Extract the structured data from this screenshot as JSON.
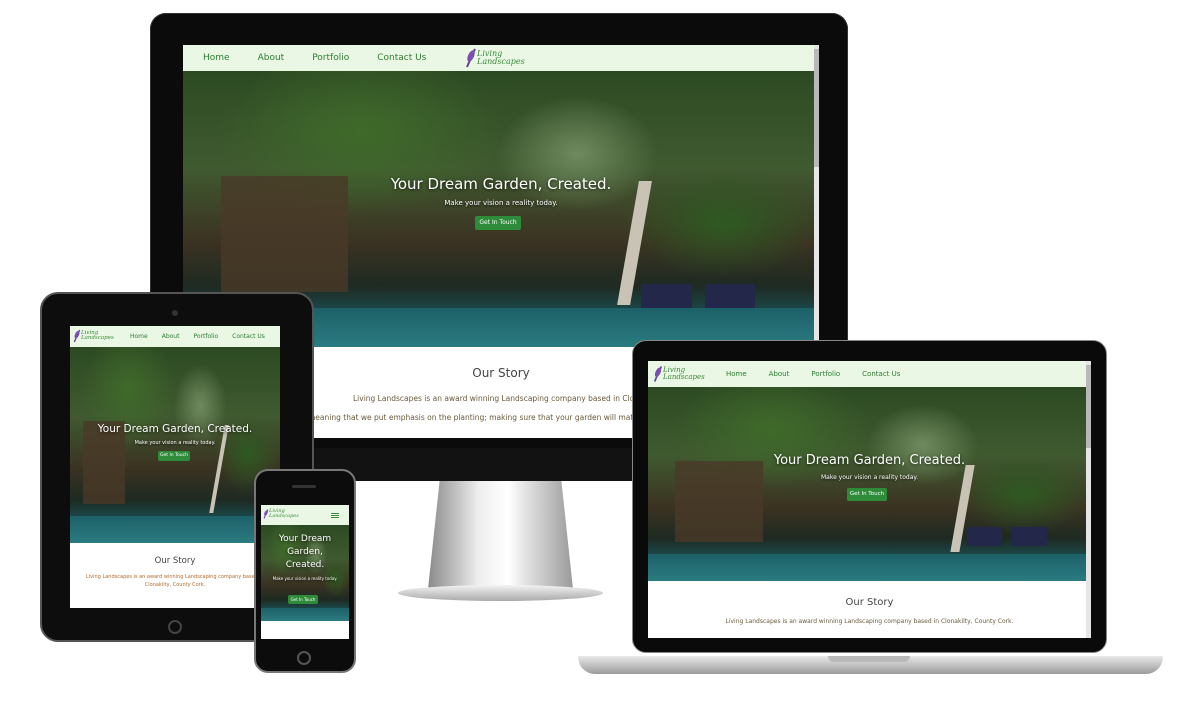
{
  "site": {
    "logo_line1": "Living",
    "logo_line2": "Landscapes",
    "nav": [
      "Home",
      "About",
      "Portfolio",
      "Contact Us"
    ],
    "hero_title": "Your Dream Garden, Created.",
    "hero_title_phone_1": "Your Dream",
    "hero_title_phone_2": "Garden,",
    "hero_title_phone_3": "Created.",
    "hero_subtitle": "Make your vision a reality today.",
    "cta_label": "Get In Touch",
    "story_title": "Our Story",
    "story_line1_monitor": "Living Landscapes is an award winning Landscaping company based in Clonakilty, Co",
    "story_line2_monitor": "meaning that we put emphasis on the planting; making sure that your garden will match your",
    "story_line1_laptop": "Living Landscapes is an award winning Landscaping company based in Clonakilty, County Cork.",
    "story_line1_tablet": "Living Landscapes is an award winning Landscaping company based in",
    "story_line2_tablet": "Clonakilty, County Cork."
  },
  "colors": {
    "nav_bg": "#e9f7e4",
    "nav_text": "#2e7d32",
    "cta_bg": "#2e8b3a",
    "logo_text": "#3c8a3c",
    "leaf": "#6a3d9a"
  }
}
